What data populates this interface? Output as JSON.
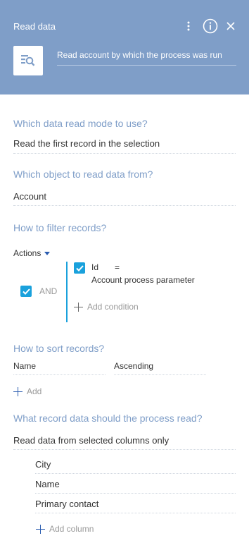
{
  "header": {
    "title": "Read data",
    "caption": "Read account by which the process was run",
    "icons": [
      "more-vertical-icon",
      "info-icon",
      "close-icon",
      "read-data-icon"
    ],
    "background_color": "#7f9ec8"
  },
  "read_mode": {
    "question": "Which data read mode to use?",
    "value": "Read the first record in the selection"
  },
  "object": {
    "question": "Which object to read data from?",
    "value": "Account"
  },
  "filter": {
    "question": "How to filter records?",
    "actions_label": "Actions",
    "group_operator": "AND",
    "group_checked": true,
    "conditions": [
      {
        "column": "Id",
        "operator": "=",
        "value": "Account process parameter",
        "checked": true
      }
    ],
    "add_condition_label": "Add condition"
  },
  "sort": {
    "question": "How to sort records?",
    "rows": [
      {
        "column": "Name",
        "direction": "Ascending"
      }
    ],
    "add_label": "Add"
  },
  "read_columns": {
    "question": "What record data should the process read?",
    "value": "Read data from selected columns only",
    "columns": [
      "City",
      "Name",
      "Primary contact"
    ],
    "add_column_label": "Add column"
  },
  "colors": {
    "accent": "#7f9ec8",
    "checkbox": "#1aa1dc",
    "link": "#2a5cb0"
  }
}
